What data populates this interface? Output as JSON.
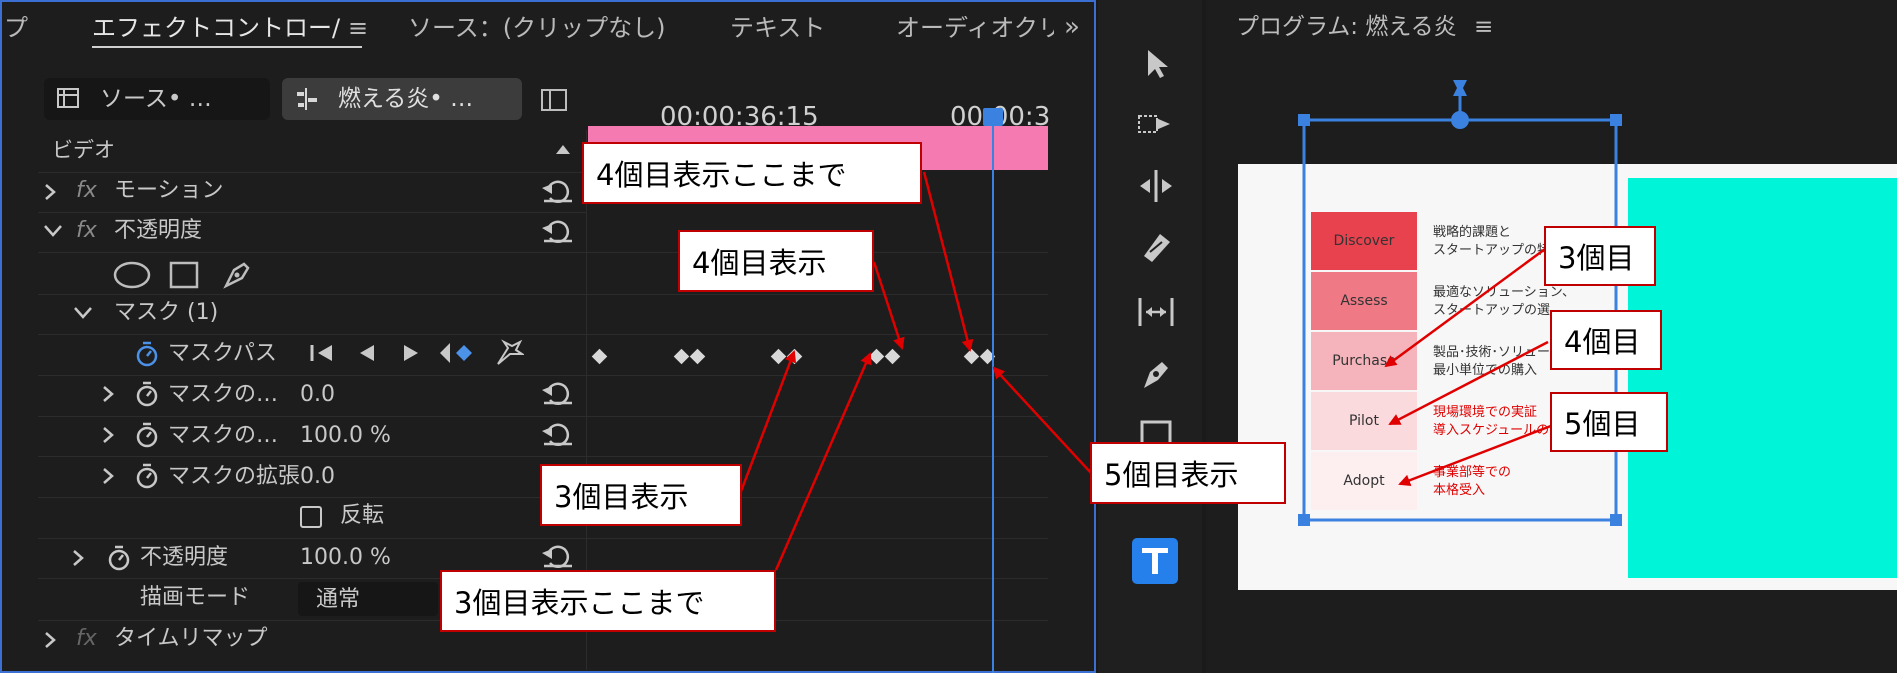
{
  "left_tabs": {
    "partial": "プ",
    "effect_controls": "エフェクトコントロー/",
    "source": "ソース：(クリップなし)",
    "text": "テキスト",
    "audio": "オーディオクリ",
    "menu_glyph": "≡",
    "overflow": "»"
  },
  "clip_tabs": {
    "source_clip": "ソース• …",
    "sequence_clip": "燃える炎• …"
  },
  "timeline": {
    "timecode_1": "00:00:36:15",
    "timecode_2": "00:00:3"
  },
  "effects": {
    "section_video": "ビデオ",
    "motion": "モーション",
    "opacity": "不透明度",
    "mask": "マスク (1)",
    "mask_path": "マスクパス",
    "mask_feather_label": "マスクの…",
    "mask_feather_value": "0.0",
    "mask_opacity_label": "マスクの…",
    "mask_opacity_value": "100.0 %",
    "mask_expansion_label": "マスクの拡張",
    "mask_expansion_value": "0.0",
    "invert_label": "反転",
    "opacity_param_label": "不透明度",
    "opacity_param_value": "100.0 %",
    "blend_mode_label": "描画モード",
    "blend_mode_value": "通常",
    "time_remap": "タイムリマップ",
    "fx": "fx"
  },
  "program": {
    "title": "プログラム: 燃える炎",
    "menu_glyph": "≡"
  },
  "slide": {
    "steps": [
      "Discover",
      "Assess",
      "Purchase",
      "Pilot",
      "Adopt"
    ],
    "desc_1": [
      "戦略的課題と",
      "スタートアップの特"
    ],
    "desc_2": [
      "最適なソリューション、",
      "スタートアップの選"
    ],
    "desc_3": [
      "製品･技術･ソリュー",
      "最小単位での購入"
    ],
    "desc_4": [
      "現場環境での実証",
      "導入スケジュールの"
    ],
    "desc_5": [
      "事業部等での",
      "本格受入"
    ]
  },
  "callouts": {
    "c4_until": "4個目表示ここまで",
    "c4_show": "4個目表示",
    "c3_show": "3個目表示",
    "c3_until": "3個目表示ここまで",
    "c5_show": "5個目表示",
    "r3": "3個目",
    "r4": "4個目",
    "r5": "5個目"
  },
  "colors": {
    "accent_blue": "#4b92e8",
    "playhead": "#3b82e0",
    "callout_red": "#e00000",
    "clip_pink": "#f57ab2",
    "slide_cyan": "#00f5d8",
    "step_red": "#e8424e"
  }
}
